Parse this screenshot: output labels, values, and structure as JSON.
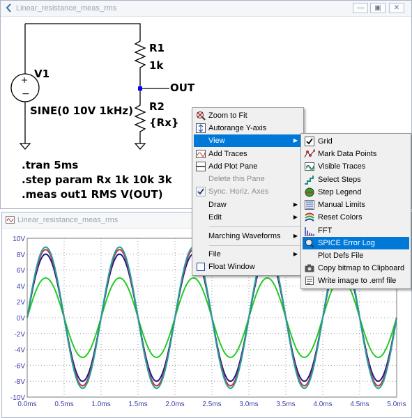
{
  "schematic_window": {
    "title": "Linear_resistance_meas_rms",
    "labels": {
      "source": "V1",
      "source_value": "SINE(0 10V 1kHz)",
      "r1_name": "R1",
      "r1_value": "1k",
      "r2_name": "R2",
      "r2_value": "{Rx}",
      "net": "OUT"
    },
    "directives": [
      ".tran 5ms",
      ".step param Rx 1k 10k 3k",
      ".meas out1 RMS V(OUT)"
    ]
  },
  "plot_window": {
    "title": "Linear_resistance_meas_rms"
  },
  "context_menu": {
    "items": [
      {
        "label": "Zoom to Fit",
        "icon": "zoom-fit-icon"
      },
      {
        "label": "Autorange Y-axis",
        "icon": "autorange-icon"
      },
      {
        "label": "View",
        "submenu": true,
        "highlighted": true
      },
      {
        "label": "Add Traces",
        "icon": "add-traces-icon"
      },
      {
        "label": "Add Plot Pane",
        "icon": "add-plot-pane-icon"
      },
      {
        "label": "Delete this Pane",
        "disabled": true
      },
      {
        "label": "Sync. Horiz. Axes",
        "disabled": true,
        "checked": true
      },
      {
        "label": "Draw",
        "submenu": true
      },
      {
        "label": "Edit",
        "submenu": true
      },
      {
        "label": "Marching Waveforms",
        "submenu": true
      },
      {
        "label": "File",
        "submenu": true
      },
      {
        "label": "Float Window",
        "icon": "float-window-icon"
      }
    ]
  },
  "view_submenu": {
    "items": [
      {
        "label": "Grid",
        "icon": "check-icon"
      },
      {
        "label": "Mark Data Points",
        "icon": "mark-points-icon"
      },
      {
        "label": "Visible Traces",
        "icon": "visible-traces-icon"
      },
      {
        "label": "Select Steps",
        "icon": "select-steps-icon"
      },
      {
        "label": "Step Legend",
        "icon": "step-legend-icon"
      },
      {
        "label": "Manual Limits",
        "icon": "manual-limits-icon"
      },
      {
        "label": "Reset Colors",
        "icon": "reset-colors-icon"
      },
      {
        "label": "FFT",
        "icon": "fft-icon"
      },
      {
        "label": "SPICE Error Log",
        "icon": "error-log-icon",
        "highlighted": true
      },
      {
        "label": "Plot Defs File"
      },
      {
        "label": "Copy bitmap to Clipboard",
        "icon": "camera-icon"
      },
      {
        "label": "Write image to .emf file",
        "icon": "emf-icon"
      }
    ]
  },
  "colors": {
    "accent": "#0078d7",
    "wire": "#000000",
    "junction": "#0000ff",
    "trace_green": "#22cc22",
    "trace_navy": "#1a1a8c",
    "trace_red": "#cc3333",
    "trace_teal": "#22a0a0",
    "axis_text": "#3a3aa8",
    "grid": "#9a9a9a"
  },
  "chart_data": {
    "type": "line",
    "x_tick_labels": [
      "0.0ms",
      "0.5ms",
      "1.0ms",
      "1.5ms",
      "2.0ms",
      "2.5ms",
      "3.0ms",
      "3.5ms",
      "4.0ms",
      "4.5ms",
      "5.0ms"
    ],
    "y_tick_labels": [
      "10V",
      "8V",
      "6V",
      "4V",
      "2V",
      "0V",
      "-2V",
      "-4V",
      "-6V",
      "-8V",
      "-10V"
    ],
    "xlim": [
      0,
      5
    ],
    "ylim": [
      -10,
      10
    ],
    "x_unit": "ms",
    "grid": true,
    "frequency_khz": 1,
    "series": [
      {
        "amplitude": 5.0,
        "color": "#22cc22"
      },
      {
        "amplitude": 8.0,
        "color": "#1a1a8c"
      },
      {
        "amplitude": 8.57,
        "color": "#cc3333"
      },
      {
        "amplitude": 8.89,
        "color": "#22a0a0"
      }
    ]
  }
}
